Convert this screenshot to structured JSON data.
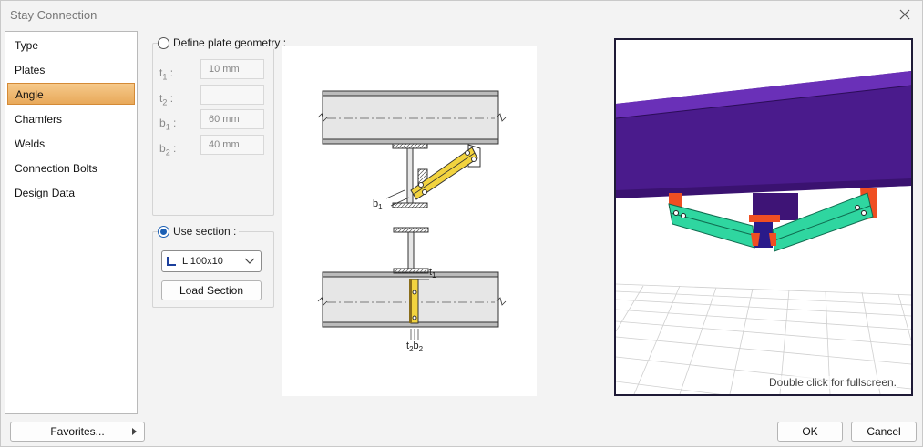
{
  "window": {
    "title": "Stay Connection"
  },
  "sidebar": {
    "items": [
      "Type",
      "Plates",
      "Angle",
      "Chamfers",
      "Welds",
      "Connection Bolts",
      "Design Data"
    ],
    "active": "Angle"
  },
  "plate_geometry": {
    "label": "Define plate geometry :",
    "selected": false,
    "fields": [
      {
        "sym": "t",
        "sub": "1",
        "value": "10 mm"
      },
      {
        "sym": "t",
        "sub": "2",
        "value": ""
      },
      {
        "sym": "b",
        "sub": "1",
        "value": "60 mm"
      },
      {
        "sym": "b",
        "sub": "2",
        "value": "40 mm"
      }
    ]
  },
  "use_section": {
    "label": "Use section :",
    "selected": true,
    "section_value": "L 100x10",
    "load_button": "Load Section"
  },
  "drawing": {
    "labels": {
      "b1": "b",
      "b1_sub": "1",
      "t1": "t",
      "t1_sub": "1",
      "t2b2": "t",
      "t2b2_sub1": "2",
      "t2b2_mid": "b",
      "t2b2_sub2": "2"
    }
  },
  "view3d": {
    "hint": "Double click for fullscreen."
  },
  "footer": {
    "favorites": "Favorites...",
    "ok": "OK",
    "cancel": "Cancel"
  },
  "colors": {
    "accent": "#1b5fb4",
    "beam": "#4b1a8c",
    "angle": "#2fd6a0",
    "plate": "#ef4f22",
    "selected": "#eab06c"
  }
}
